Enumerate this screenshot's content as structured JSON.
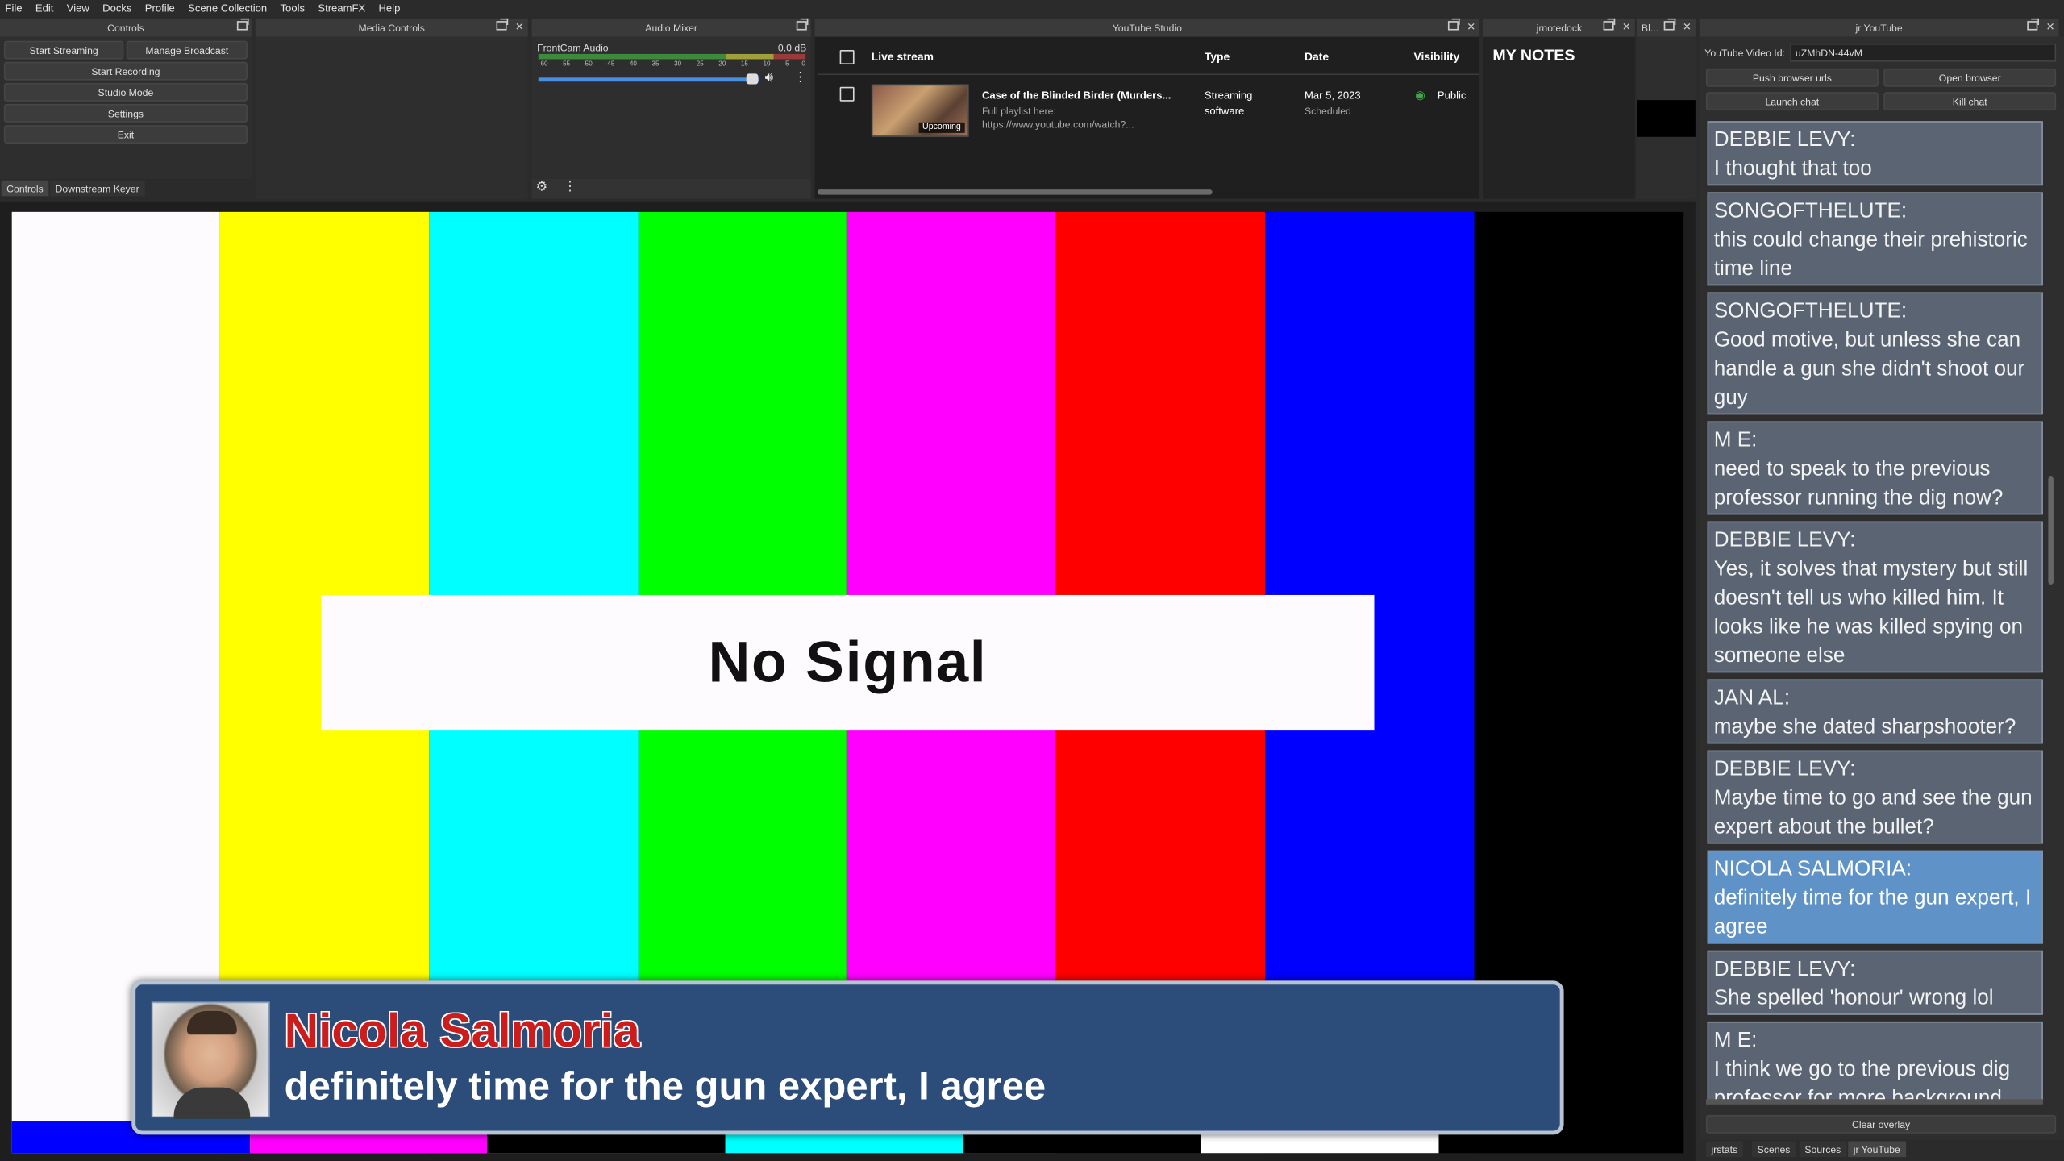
{
  "menu": [
    "File",
    "Edit",
    "View",
    "Docks",
    "Profile",
    "Scene Collection",
    "Tools",
    "StreamFX",
    "Help"
  ],
  "docks": {
    "controls": {
      "title": "Controls"
    },
    "media": {
      "title": "Media Controls"
    },
    "mixer": {
      "title": "Audio Mixer"
    },
    "studio": {
      "title": "YouTube Studio"
    },
    "notes": {
      "title": "jrnotedock"
    },
    "bl": {
      "title": "Bl..."
    },
    "jr": {
      "title": "jr YouTube"
    }
  },
  "controls": {
    "start_streaming": "Start Streaming",
    "manage_broadcast": "Manage Broadcast",
    "start_recording": "Start Recording",
    "studio_mode": "Studio Mode",
    "settings": "Settings",
    "exit": "Exit",
    "tabs": [
      "Controls",
      "Downstream Keyer"
    ]
  },
  "mixer": {
    "source": "FrontCam Audio",
    "level": "0.0 dB",
    "ticks": [
      "-60",
      "-55",
      "-50",
      "-45",
      "-40",
      "-35",
      "-30",
      "-25",
      "-20",
      "-15",
      "-10",
      "-5",
      "0"
    ],
    "volume_fraction": 1.0
  },
  "studio": {
    "headers": {
      "stream": "Live stream",
      "type": "Type",
      "date": "Date",
      "visibility": "Visibility"
    },
    "row": {
      "title": "Case of the Blinded Birder (Murders...",
      "desc1": "Full playlist here:",
      "desc2": "https://www.youtube.com/watch?...",
      "thumb_badge": "Upcoming",
      "type1": "Streaming",
      "type2": "software",
      "date": "Mar 5, 2023",
      "status": "Scheduled",
      "visibility": "Public"
    }
  },
  "notes": {
    "heading": "MY NOTES"
  },
  "jr": {
    "video_id_label": "YouTube Video Id:",
    "video_id": "uZMhDN-44vM",
    "push": "Push browser urls",
    "open": "Open browser",
    "launch": "Launch chat",
    "kill": "Kill chat",
    "clear": "Clear overlay",
    "tabs": [
      "jrstats",
      "Scenes",
      "Sources",
      "jr YouTube"
    ],
    "messages": [
      {
        "author": "DEBBIE LEVY:",
        "text": "I thought that too"
      },
      {
        "author": "SONGOFTHELUTE:",
        "text": "this could change their prehistoric time line"
      },
      {
        "author": "SONGOFTHELUTE:",
        "text": "Good motive, but unless she can handle a gun she didn't shoot our guy"
      },
      {
        "author": "M E:",
        "text": "need to speak to the previous professor running the dig now?"
      },
      {
        "author": "DEBBIE LEVY:",
        "text": "Yes, it solves that mystery but still doesn't tell us who killed him. It looks like he was killed spying on someone else"
      },
      {
        "author": "JAN AL:",
        "text": "maybe she dated sharpshooter?"
      },
      {
        "author": "DEBBIE LEVY:",
        "text": "Maybe time to go and see the gun expert about the bullet?"
      },
      {
        "author": "NICOLA SALMORIA:",
        "text": "definitely time for the gun expert, I agree"
      },
      {
        "author": "DEBBIE LEVY:",
        "text": "She spelled 'honour' wrong lol"
      },
      {
        "author": "M E:",
        "text": "I think we go to the previous dig professor for more background"
      }
    ]
  },
  "preview": {
    "no_signal": "No Signal",
    "overlay_name": "Nicola Salmoria",
    "overlay_text": "definitely time for the gun expert, I agree"
  },
  "colors": {
    "bars": [
      "#fdfbfd",
      "#ffff00",
      "#00ffff",
      "#00ff00",
      "#ff00ff",
      "#ff0000",
      "#0000ff",
      "#000000"
    ],
    "lower": [
      "#0000ff",
      "#ff00ff",
      "#000000",
      "#00ffff",
      "#000000",
      "#ffffff",
      "#000000"
    ],
    "overlay_name": "#cc1c1c",
    "overlay_bg": "#2c4d7a",
    "chat_highlight": "#5f93c8"
  }
}
